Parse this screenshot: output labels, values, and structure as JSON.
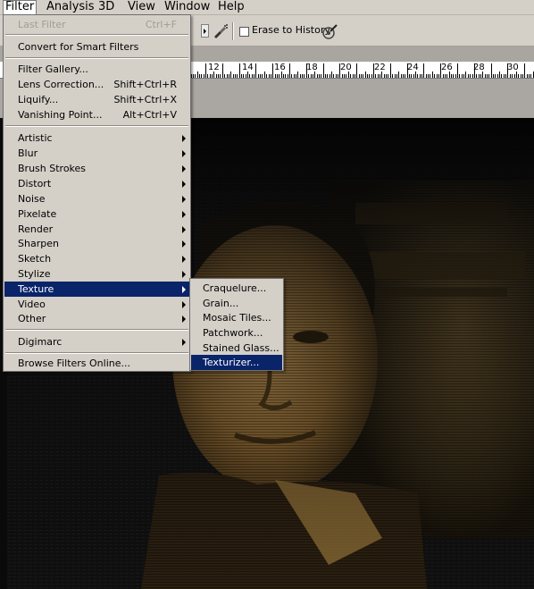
{
  "menubar": {
    "items": [
      "Filter",
      "Analysis",
      "3D",
      "View",
      "Window",
      "Help"
    ]
  },
  "options_bar": {
    "erase_to_history_label": "Erase to History"
  },
  "ruler": {
    "numbers": [
      "12",
      "14",
      "16",
      "18",
      "20",
      "22",
      "24",
      "26",
      "28",
      "30"
    ]
  },
  "filter_menu": {
    "last_filter": {
      "label": "Last Filter",
      "shortcut": "Ctrl+F"
    },
    "convert_smart": "Convert for Smart Filters",
    "filter_gallery": "Filter Gallery...",
    "lens_correction": {
      "label": "Lens Correction...",
      "shortcut": "Shift+Ctrl+R"
    },
    "liquify": {
      "label": "Liquify...",
      "shortcut": "Shift+Ctrl+X"
    },
    "vanishing_point": {
      "label": "Vanishing Point...",
      "shortcut": "Alt+Ctrl+V"
    },
    "submenus": [
      "Artistic",
      "Blur",
      "Brush Strokes",
      "Distort",
      "Noise",
      "Pixelate",
      "Render",
      "Sharpen",
      "Sketch",
      "Stylize",
      "Texture",
      "Video",
      "Other"
    ],
    "digimarc": "Digimarc",
    "browse_online": "Browse Filters Online..."
  },
  "texture_menu": {
    "items": [
      "Craquelure...",
      "Grain...",
      "Mosaic Tiles...",
      "Patchwork...",
      "Stained Glass...",
      "Texturizer..."
    ]
  },
  "highlight": {
    "active_menu": "Filter",
    "active_submenu": "Texture",
    "active_item": "Texturizer..."
  },
  "colors": {
    "menu_bg": "#d4d0c8",
    "highlight": "#0a246a",
    "sepia": "#b08a48"
  }
}
